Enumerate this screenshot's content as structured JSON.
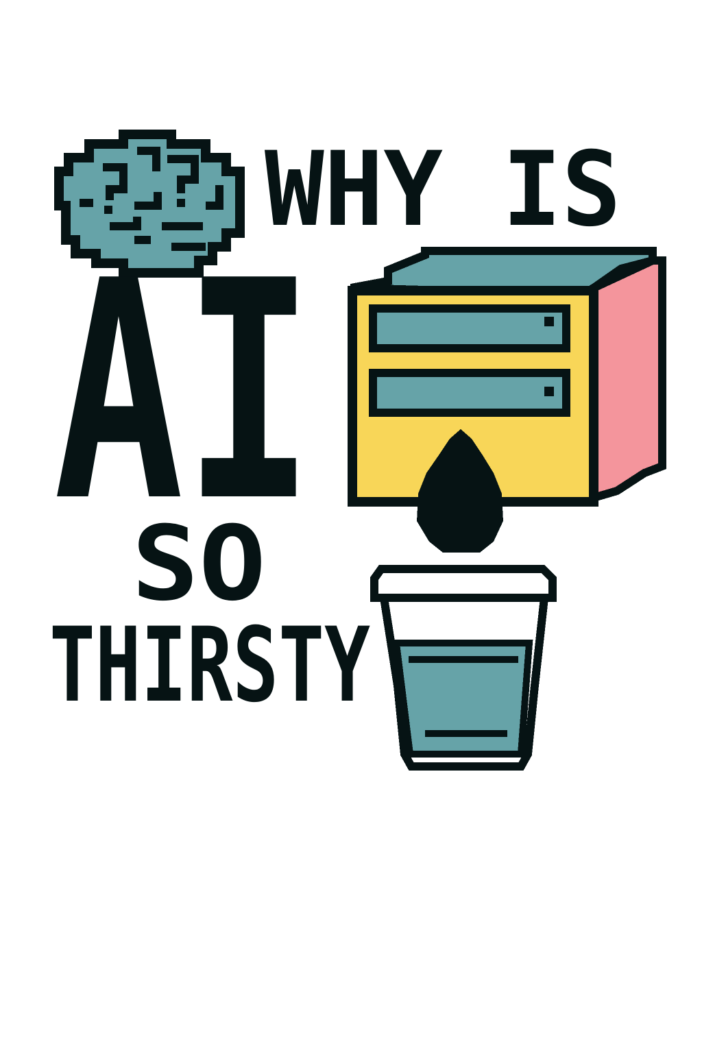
{
  "headline": {
    "line1": "WHY IS",
    "line2": "AI",
    "line3": "SO",
    "line4": "THIRSTY"
  },
  "icons": {
    "brain": "brain-icon",
    "server": "server-icon",
    "droplet": "water-drop-icon",
    "cup": "water-cup-icon"
  },
  "colors": {
    "ink": "#061314",
    "teal": "#66a3a8",
    "yellow": "#f8d658",
    "pink": "#f4959c",
    "white": "#ffffff"
  }
}
